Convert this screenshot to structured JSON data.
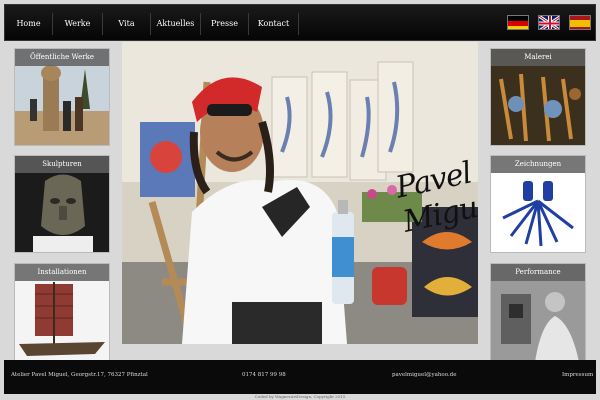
{
  "nav": {
    "items": [
      "Home",
      "Werke",
      "Vita",
      "Aktuelles",
      "Presse",
      "Kontact"
    ]
  },
  "flags": [
    "german-flag-icon",
    "uk-flag-icon",
    "spanish-flag-icon"
  ],
  "left_tiles": [
    {
      "caption": "Öffentliche Werke"
    },
    {
      "caption": "Skulpturen"
    },
    {
      "caption": "Installationen"
    }
  ],
  "right_tiles": [
    {
      "caption": "Malerei"
    },
    {
      "caption": "Zeichnungen"
    },
    {
      "caption": "Performance"
    }
  ],
  "hero": {
    "signature": "Pavel Miguel"
  },
  "footer": {
    "address": "Atelier Pavel Miguel, Georgstr.17, 76327 Pfinztal",
    "phone": "0174 817 99 98",
    "email": "pavelmiguel@yahoo.de",
    "impressum": "Impressum"
  },
  "credit": "Coded by WagnerArtDesign, Copyright 2015",
  "colors": {
    "bar": "#0a0a0a",
    "caption_bg": "#5f5f5f",
    "page_bg": "#d9d9d9"
  }
}
